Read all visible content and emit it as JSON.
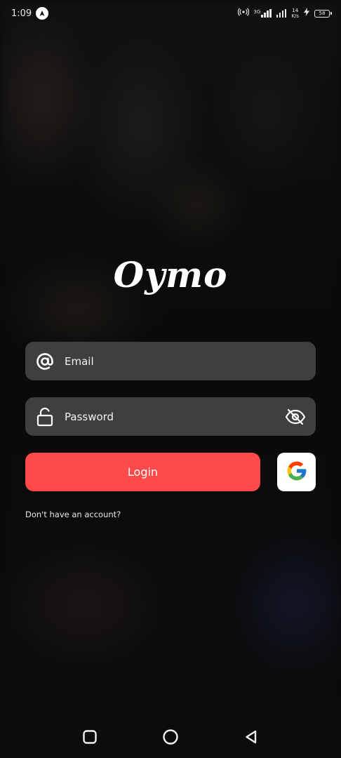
{
  "status_bar": {
    "time": "1:09",
    "network_type": "3G",
    "speed_value": "14",
    "speed_unit": "K/s",
    "battery": "58"
  },
  "app": {
    "logo_text": "Oymo"
  },
  "form": {
    "email_label": "Email",
    "password_label": "Password",
    "login_label": "Login",
    "signup_text": "Don't have an account?"
  },
  "colors": {
    "accent": "#ff4a4a",
    "field_bg": "#4e4e50",
    "background": "#0b0b0c"
  },
  "icons": {
    "email": "at-sign-icon",
    "password": "unlock-icon",
    "visibility": "eye-off-icon",
    "google": "google-icon"
  }
}
